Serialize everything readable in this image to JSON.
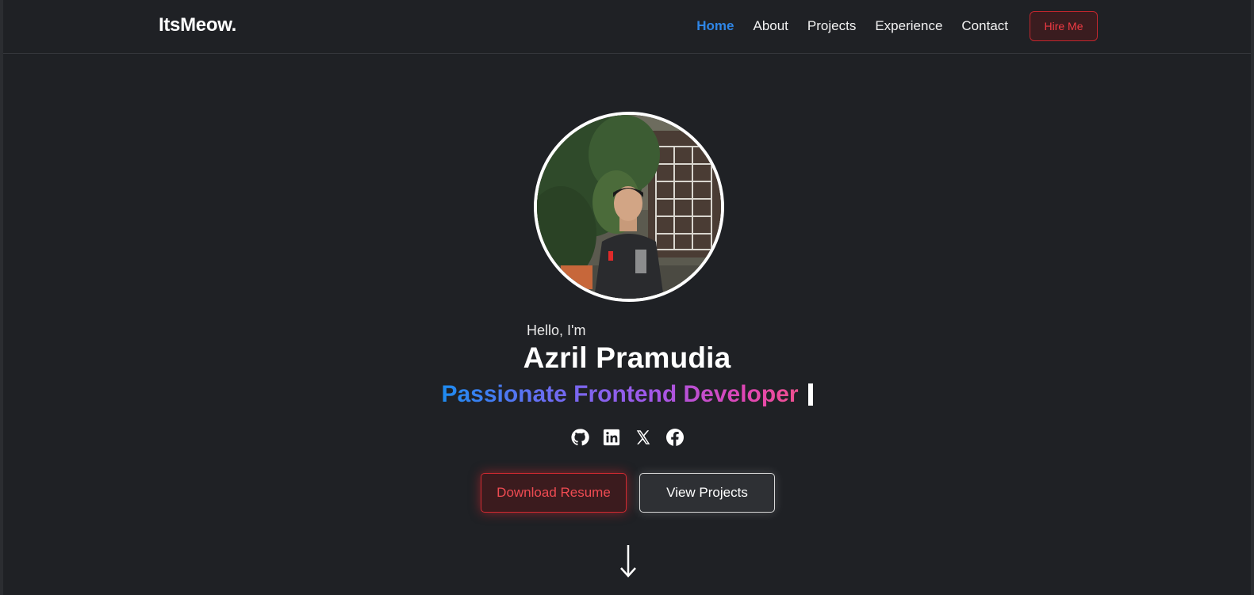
{
  "nav": {
    "logo": "ItsMeow.",
    "links": [
      {
        "label": "Home",
        "active": true
      },
      {
        "label": "About",
        "active": false
      },
      {
        "label": "Projects",
        "active": false
      },
      {
        "label": "Experience",
        "active": false
      },
      {
        "label": "Contact",
        "active": false
      }
    ],
    "hire_label": "Hire Me"
  },
  "hero": {
    "greeting": "Hello, I'm",
    "name": "Azril Pramudia",
    "tagline": "Passionate Frontend Developer",
    "socials": [
      {
        "icon": "github-icon"
      },
      {
        "icon": "linkedin-icon"
      },
      {
        "icon": "x-icon"
      },
      {
        "icon": "facebook-icon"
      }
    ],
    "resume_label": "Download Resume",
    "projects_label": "View Projects",
    "scroll_icon": "arrow-down-icon"
  },
  "colors": {
    "background": "#1f2125",
    "accent_blue": "#2f86e6",
    "accent_red": "#ef3a43",
    "gradient": [
      "#1d8bf0",
      "#a357e8",
      "#f0508f"
    ]
  }
}
